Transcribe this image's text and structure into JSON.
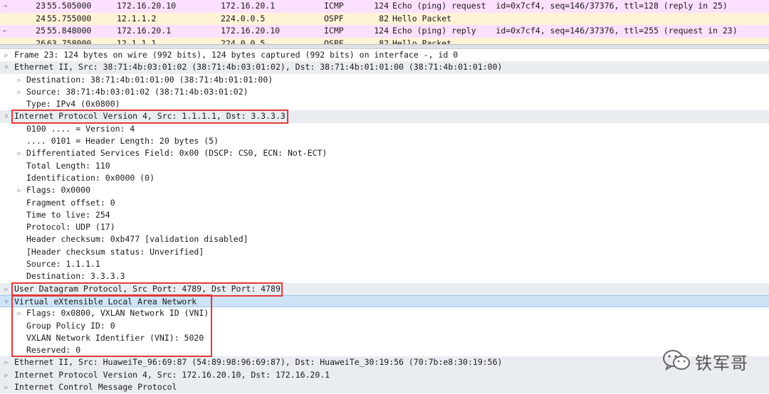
{
  "packets": [
    {
      "arrow": "→",
      "no": "23",
      "time": "55.505000",
      "src": "172.16.20.10",
      "dst": "172.16.20.1",
      "proto": "ICMP",
      "len": "124",
      "info": "Echo (ping) request  id=0x7cf4, seq=146/37376, ttl=128 (reply in 25)"
    },
    {
      "arrow": "",
      "no": "24",
      "time": "55.755000",
      "src": "12.1.1.2",
      "dst": "224.0.0.5",
      "proto": "OSPF",
      "len": "82",
      "info": "Hello Packet"
    },
    {
      "arrow": "←",
      "no": "25",
      "time": "55.848000",
      "src": "172.16.20.1",
      "dst": "172.16.20.10",
      "proto": "ICMP",
      "len": "124",
      "info": "Echo (ping) reply    id=0x7cf4, seq=146/37376, ttl=255 (request in 23)"
    },
    {
      "arrow": "",
      "no": "26",
      "time": "63.758000",
      "src": "12.1.1.1",
      "dst": "224.0.0.5",
      "proto": "OSPF",
      "len": "82",
      "info": "Hello Packet"
    }
  ],
  "details": [
    {
      "level": 0,
      "expander": "▷",
      "text": "Frame 23: 124 bytes on wire (992 bits), 124 bytes captured (992 bits) on interface -, id 0"
    },
    {
      "level": 0,
      "expander": "▽",
      "text": "Ethernet II, Src: 38:71:4b:03:01:02 (38:71:4b:03:01:02), Dst: 38:71:4b:01:01:00 (38:71:4b:01:01:00)"
    },
    {
      "level": 1,
      "expander": "▷",
      "text": "Destination: 38:71:4b:01:01:00 (38:71:4b:01:01:00)"
    },
    {
      "level": 1,
      "expander": "▷",
      "text": "Source: 38:71:4b:03:01:02 (38:71:4b:03:01:02)"
    },
    {
      "level": 1,
      "expander": "",
      "text": "Type: IPv4 (0x0800)"
    },
    {
      "level": 0,
      "expander": "▽",
      "text": "Internet Protocol Version 4, Src: 1.1.1.1, Dst: 3.3.3.3"
    },
    {
      "level": 1,
      "expander": "",
      "text": "0100 .... = Version: 4"
    },
    {
      "level": 1,
      "expander": "",
      "text": ".... 0101 = Header Length: 20 bytes (5)"
    },
    {
      "level": 1,
      "expander": "▷",
      "text": "Differentiated Services Field: 0x00 (DSCP: CS0, ECN: Not-ECT)"
    },
    {
      "level": 1,
      "expander": "",
      "text": "Total Length: 110"
    },
    {
      "level": 1,
      "expander": "",
      "text": "Identification: 0x0000 (0)"
    },
    {
      "level": 1,
      "expander": "▷",
      "text": "Flags: 0x0000"
    },
    {
      "level": 1,
      "expander": "",
      "text": "Fragment offset: 0"
    },
    {
      "level": 1,
      "expander": "",
      "text": "Time to live: 254"
    },
    {
      "level": 1,
      "expander": "",
      "text": "Protocol: UDP (17)"
    },
    {
      "level": 1,
      "expander": "",
      "text": "Header checksum: 0xb477 [validation disabled]"
    },
    {
      "level": 1,
      "expander": "",
      "text": "[Header checksum status: Unverified]"
    },
    {
      "level": 1,
      "expander": "",
      "text": "Source: 1.1.1.1"
    },
    {
      "level": 1,
      "expander": "",
      "text": "Destination: 3.3.3.3"
    },
    {
      "level": 0,
      "expander": "▷",
      "text": "User Datagram Protocol, Src Port: 4789, Dst Port: 4789"
    },
    {
      "level": 0,
      "expander": "▽",
      "text": "Virtual eXtensible Local Area Network"
    },
    {
      "level": 1,
      "expander": "▷",
      "text": "Flags: 0x0800, VXLAN Network ID (VNI)"
    },
    {
      "level": 1,
      "expander": "",
      "text": "Group Policy ID: 0"
    },
    {
      "level": 1,
      "expander": "",
      "text": "VXLAN Network Identifier (VNI): 5020"
    },
    {
      "level": 1,
      "expander": "",
      "text": "Reserved: 0"
    },
    {
      "level": 0,
      "expander": "▷",
      "text": "Ethernet II, Src: HuaweiTe_96:69:87 (54:89:98:96:69:87), Dst: HuaweiTe_30:19:56 (70:7b:e8:30:19:56)"
    },
    {
      "level": 0,
      "expander": "▷",
      "text": "Internet Protocol Version 4, Src: 172.16.20.10, Dst: 172.16.20.1"
    },
    {
      "level": 0,
      "expander": "▷",
      "text": "Internet Control Message Protocol"
    }
  ],
  "watermark": {
    "icon": "wechat-icon",
    "text": "铁军哥"
  },
  "colors": {
    "icmp_row": "#fce0ff",
    "ospf_row": "#fff3d6",
    "selected_row": "#cfe3f7",
    "highlight_box": "#e23a3a"
  }
}
